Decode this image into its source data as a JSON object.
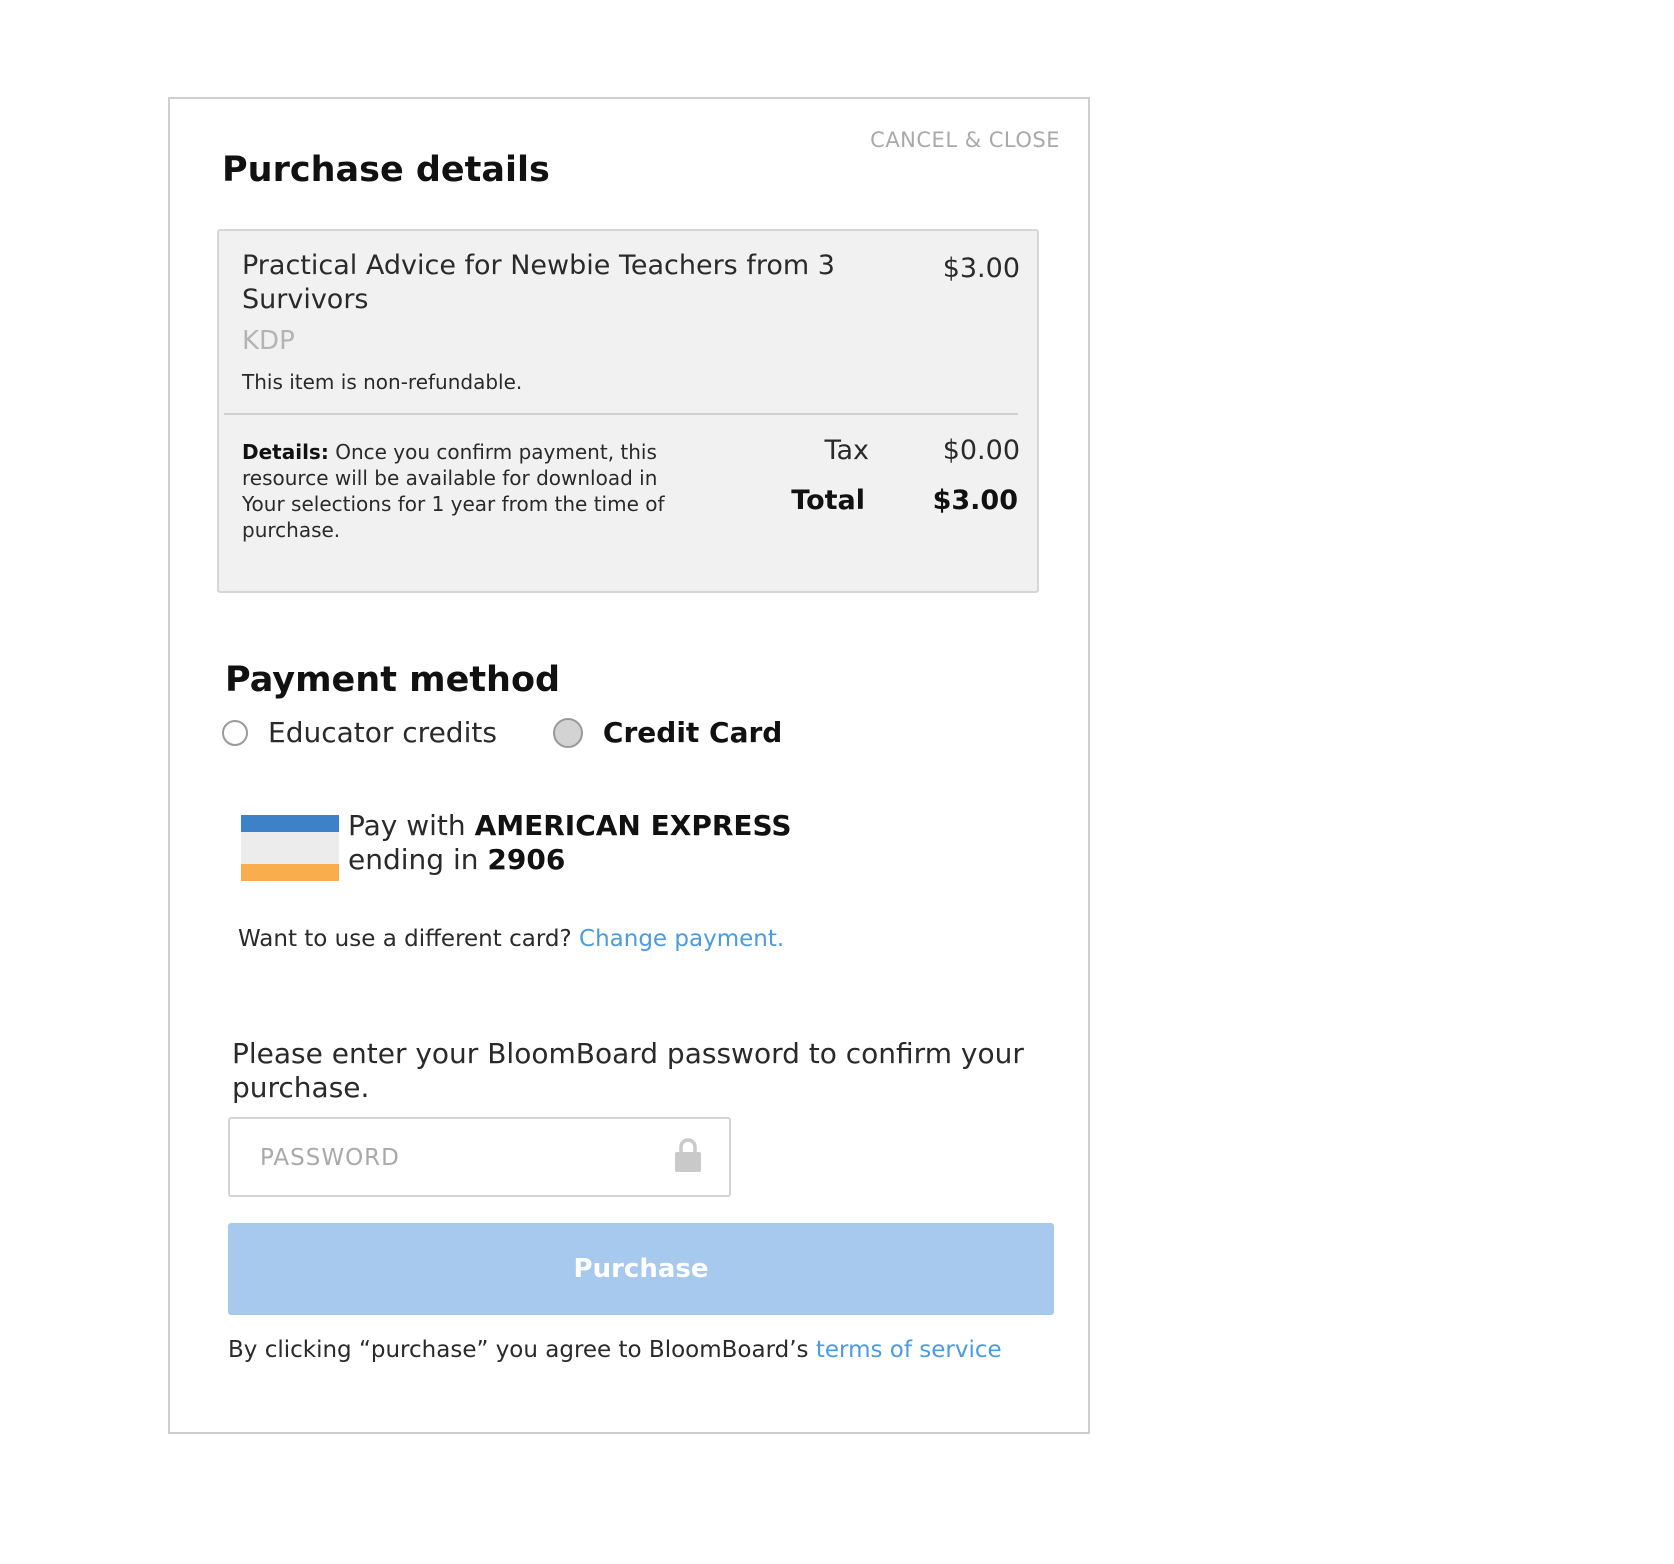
{
  "modal": {
    "cancel_close": "CANCEL & CLOSE"
  },
  "purchase_details": {
    "title": "Purchase details",
    "item": {
      "title": "Practical Advice for Newbie Teachers from 3 Survivors",
      "price": "$3.00",
      "vendor": "KDP",
      "note": "This item is non-refundable."
    },
    "details_label": "Details:",
    "details_text": " Once you confirm payment, this resource will be available for download in Your selections for 1 year from the time of purchase.",
    "tax_label": "Tax",
    "tax_value": "$0.00",
    "total_label": "Total",
    "total_value": "$3.00"
  },
  "payment_method": {
    "title": "Payment method",
    "options": [
      {
        "label": "Educator credits",
        "selected": false
      },
      {
        "label": "Credit Card",
        "selected": true
      }
    ],
    "card": {
      "pay_with": "Pay with ",
      "brand": "AMERICAN EXPRESS",
      "ending_in": "ending in ",
      "last4": "2906",
      "stripe_colors": [
        "#3d82c8",
        "#ececec",
        "#f9ad4c"
      ]
    },
    "change_prompt": "Want to use a different card? ",
    "change_link": "Change payment."
  },
  "confirm": {
    "instructions": "Please enter your BloomBoard password to confirm your purchase.",
    "password_placeholder": "PASSWORD",
    "password_value": "",
    "purchase_label": "Purchase",
    "terms_prefix": "By clicking “purchase” you agree to BloomBoard’s ",
    "terms_link": "terms of service"
  },
  "colors": {
    "link": "#4a9be0",
    "button": "#a7c9ee",
    "summary_bg": "#f1f1f1"
  }
}
